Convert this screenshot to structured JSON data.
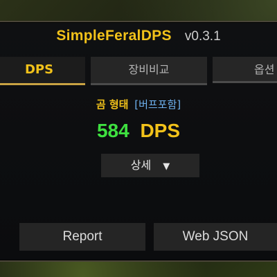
{
  "addon": {
    "title": "SimpleFeralDPS",
    "version": "v0.3.1"
  },
  "tabs": [
    {
      "label": "DPS",
      "active": true
    },
    {
      "label": "장비비교",
      "active": false
    },
    {
      "label": "옵션",
      "active": false
    }
  ],
  "main": {
    "form_label": "곰 형태",
    "buff_label": "[버프포함]",
    "dps_value": "584",
    "dps_unit": "DPS",
    "detail_label": "상세",
    "detail_arrow": "▼"
  },
  "footer": {
    "report_label": "Report",
    "web_json_label": "Web JSON"
  },
  "colors": {
    "title": "#f2c21a",
    "dps_value": "#3ee040",
    "buff": "#6fb2f0",
    "active_tab_underline": "#c9a343"
  }
}
